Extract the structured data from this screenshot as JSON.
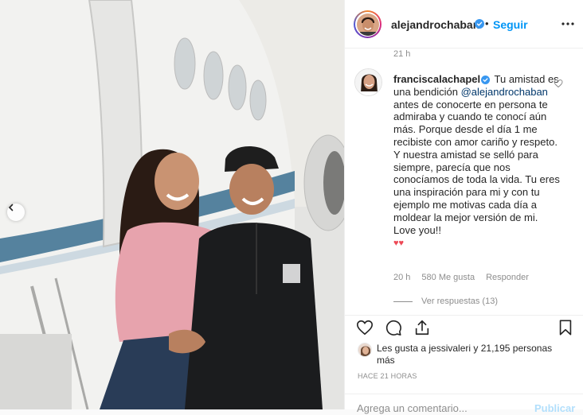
{
  "post": {
    "author": "alejandrochaban",
    "follow_label": "Seguir",
    "separator": "•",
    "time_top": "21 h",
    "more_icon": "more-options-icon"
  },
  "comment": {
    "username": "franciscalachapel",
    "text_before_mention": "Tu amistad es una bendición ",
    "mention": "@alejandrochaban",
    "text_after_mention": " antes de conocerte en persona te admiraba y cuando te conocí aún más. Porque desde el día 1 me recibiste con amor cariño y respeto. Y nuestra amistad se selló para siempre, parecía que nos conocíamos de toda la vida. Tu eres una inspiración para mi y con tu ejemplo me motivas cada día a moldear la mejor versión de mi. Love you!!",
    "emoji": "♥♥",
    "time": "20 h",
    "likes": "580 Me gusta",
    "reply_label": "Responder",
    "view_replies": "Ver respuestas (13)"
  },
  "likes": {
    "text": "Les gusta a jessivaleri y 21,195 personas más"
  },
  "post_time": "HACE 21 HORAS",
  "add_comment": {
    "placeholder": "Agrega un comentario...",
    "publish_label": "Publicar"
  },
  "colors": {
    "link_blue": "#0095f6",
    "mention_blue": "#00376b",
    "verified_blue": "#3897f0",
    "heart_red": "#ed4956",
    "muted": "#8e8e8e"
  }
}
